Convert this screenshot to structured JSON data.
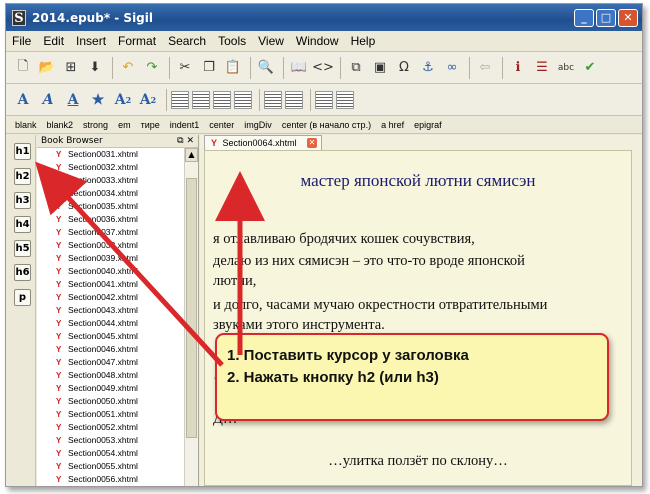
{
  "window": {
    "title": "2014.epub* - Sigil"
  },
  "menu": [
    "File",
    "Edit",
    "Insert",
    "Format",
    "Search",
    "Tools",
    "View",
    "Window",
    "Help"
  ],
  "clips": [
    "blank",
    "blank2",
    "strong",
    "em",
    "тире",
    "indent1",
    "center",
    "imgDiv",
    "center (в начало стр.)",
    "a href",
    "epigraf"
  ],
  "heading_buttons": [
    "h1",
    "h2",
    "h3",
    "h4",
    "h5",
    "h6",
    "p"
  ],
  "book_browser": {
    "title": "Book Browser",
    "items": [
      "Section0031.xhtml",
      "Section0032.xhtml",
      "Section0033.xhtml",
      "Section0034.xhtml",
      "Section0035.xhtml",
      "Section0036.xhtml",
      "Section0037.xhtml",
      "Section0038.xhtml",
      "Section0039.xhtml",
      "Section0040.xhtml",
      "Section0041.xhtml",
      "Section0042.xhtml",
      "Section0043.xhtml",
      "Section0044.xhtml",
      "Section0045.xhtml",
      "Section0046.xhtml",
      "Section0047.xhtml",
      "Section0048.xhtml",
      "Section0049.xhtml",
      "Section0050.xhtml",
      "Section0051.xhtml",
      "Section0052.xhtml",
      "Section0053.xhtml",
      "Section0054.xhtml",
      "Section0055.xhtml",
      "Section0056.xhtml"
    ]
  },
  "editor": {
    "tab": "Section0064.xhtml",
    "heading": "мастер японской лютни сямисэн",
    "p1": "я отлавливаю бродячих кошек сочувствия,",
    "p2a": "делаю из них сямисэн – это что-то вроде японской",
    "p2b": "лютни,",
    "p3a": "и долго, часами мучаю окрестности отвратительными",
    "p3b": "звуками этого инструмента.",
    "p4": "…",
    "p5": "Д…",
    "snail": "…улитка ползёт по склону…"
  },
  "callout": {
    "line1": "1. Поставить курсор у заголовка",
    "line2": "2. Нажать кнопку h2 (или h3)"
  },
  "colors": {
    "arrow": "#d9272a",
    "callout_bg": "#fbf7b0",
    "titlebar": "#1f4f8f"
  }
}
